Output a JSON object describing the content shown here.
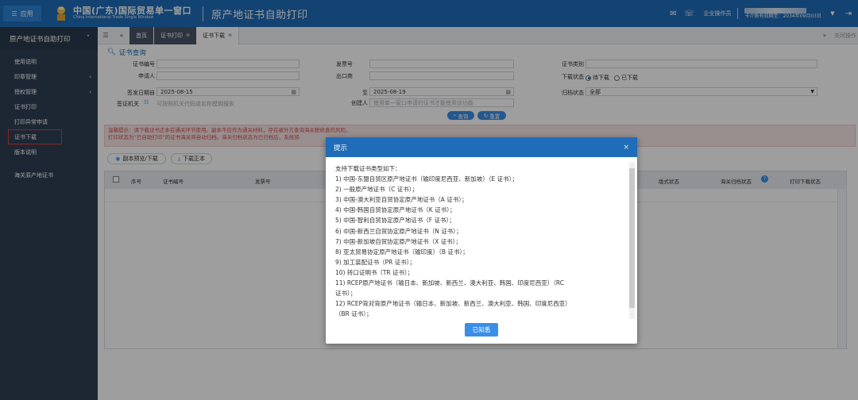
{
  "header": {
    "app_label": "应用",
    "brand_cn": "中国(广东)国际贸易单一窗口",
    "brand_en": "China International Trade Single Window",
    "title": "原产地证书自助打印",
    "role": "企业操作员",
    "expiry": "卡介质有效期至：2034年09月03日"
  },
  "sidebar": {
    "title": "原产地证书自助打印",
    "items": [
      {
        "label": "使用说明",
        "arrow": ""
      },
      {
        "label": "印章管理",
        "arrow": "‹"
      },
      {
        "label": "授权管理",
        "arrow": "‹"
      },
      {
        "label": "证书打印",
        "arrow": ""
      },
      {
        "label": "打印异常申请",
        "arrow": ""
      },
      {
        "label": "证书下载",
        "arrow": ""
      },
      {
        "label": "版本说明",
        "arrow": ""
      },
      {
        "label": "海关原产地证书",
        "arrow": ""
      }
    ]
  },
  "tabs": {
    "home": "首页",
    "print": "证书打印",
    "download": "证书下载",
    "close": "关闭操作"
  },
  "query": {
    "title": "证书查询",
    "cert_no_label": "证书编号",
    "invoice_no_label": "发票号",
    "cert_type_label": "证书类别",
    "applicant_label": "申请人",
    "exporter_label": "出口商",
    "dl_status_label": "下载状态",
    "dl_opt1": "待下载",
    "dl_opt2": "已下载",
    "date_from_label": "签发日期自",
    "date_from": "2025-08-15",
    "date_to_label": "至",
    "date_to": "2025-08-19",
    "archive_label": "归档状态",
    "archive_value": "全部",
    "issuer_label": "签证机关",
    "issuer_ph": "可按照机关代码或名称模糊搜索",
    "creator_label": "创建人",
    "creator_ph": "使用单一窗口申请的证书才能使用该功能",
    "search_btn": "查询",
    "reset_btn": "重置"
  },
  "warning": {
    "line1": "温馨提示：请下载证书正本在通关环节使用。副本不应作为通关材料，存在被外方查询海关税收查的风险。",
    "line2": "打印状态为“已自助打印”的证书海关将自动归档。海关归档状态为已归档后，系统将",
    "line2_tail": "。"
  },
  "actions": {
    "preview": "副本预览/下载",
    "download_orig": "下载正本"
  },
  "grid": {
    "headers": [
      "序号",
      "证书编号",
      "发票号",
      "版式状态",
      "海关归档状态",
      "打印下载状态"
    ]
  },
  "modal": {
    "title": "提示",
    "intro": "支持下载证书类型如下：",
    "lines": [
      "1) 中国-东盟自贸区原产地证书（输印度尼西亚、新加坡）（E 证书）；",
      "2) 一般原产地证书（C 证书）；",
      "3) 中国-澳大利亚自贸协定原产地证书（A 证书）；",
      "4) 中国-韩国自贸协定原产地证书（K 证书）；",
      "5) 中国-智利自贸协定原产地证书（F 证书）；",
      "6) 中国-新西兰自贸协定原产地证书（N 证书）；",
      "7) 中国-新加坡自贸协定原产地证书（X 证书）；",
      "8) 亚太贸易协定原产地证书（输印度）（B 证书）；",
      "9) 加工装配证书（PR 证书）；",
      "10) 转口证明书（TR 证书）；",
      "11) RCEP原产地证书（输日本、新加坡、新西兰、澳大利亚、韩国、印度尼西亚）（RC",
      "证书）；",
      "12) RCEP背对背原产地证书（输日本、新加坡、新西兰、澳大利亚、韩国、印度尼西亚）",
      "（BR 证书）；"
    ],
    "ok": "已知悉"
  }
}
